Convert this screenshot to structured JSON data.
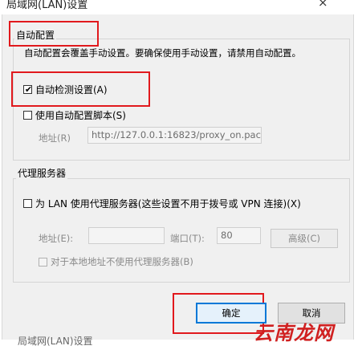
{
  "window": {
    "title": "局域网(LAN)设置",
    "close_glyph": "×"
  },
  "auto_config": {
    "group_title": "自动配置",
    "description": "自动配置会覆盖手动设置。要确保使用手动设置，请禁用自动配置。",
    "auto_detect": {
      "label": "自动检测设置(A)",
      "checked": true
    },
    "use_script": {
      "label": "使用自动配置脚本(S)",
      "checked": false
    },
    "address_label": "地址(R)",
    "address_value": "http://127.0.0.1:16823/proxy_on.pac"
  },
  "proxy_server": {
    "group_title": "代理服务器",
    "use_proxy": {
      "label": "为 LAN 使用代理服务器(这些设置不用于拨号或 VPN 连接)(X)",
      "checked": false
    },
    "address_label": "地址(E):",
    "address_value": "",
    "port_label": "端口(T):",
    "port_value": "80",
    "advanced_label": "高级(C)",
    "bypass_local": {
      "label": "对于本地地址不使用代理服务器(B)",
      "checked": false
    }
  },
  "buttons": {
    "ok_label": "确定",
    "cancel_label": "取消"
  },
  "footer_title": "局域网(LAN)设置",
  "watermark": "云南龙网",
  "highlight_color": "#e1191d"
}
